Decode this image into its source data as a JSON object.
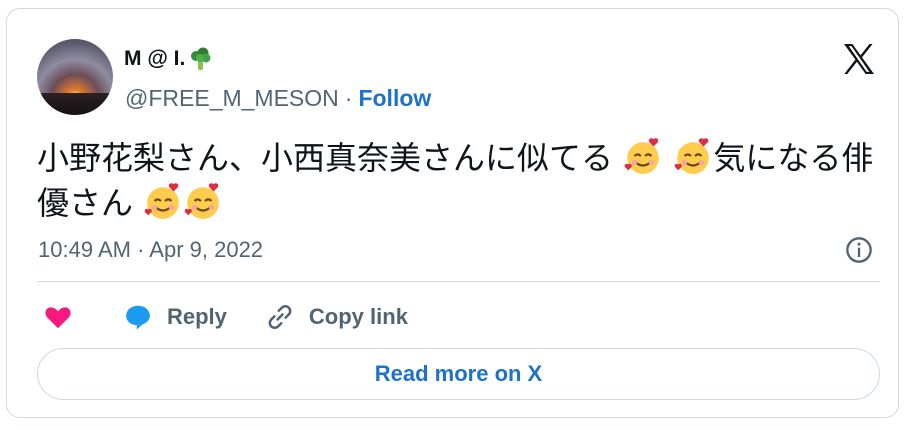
{
  "user": {
    "display_name": "M @ I.",
    "handle": "@FREE_M_MESON",
    "follow_label": "Follow",
    "separator": "·"
  },
  "tweet": {
    "text_part1": "小野花梨さん、小西真奈美さんに似てる",
    "text_part2": "気になる俳優さん",
    "timestamp": "10:49 AM · Apr 9, 2022"
  },
  "actions": {
    "reply_label": "Reply",
    "copy_link_label": "Copy link"
  },
  "footer": {
    "read_more_label": "Read more on X"
  },
  "icons": [
    "broccoli-emoji-icon",
    "x-logo-icon",
    "smiling-face-with-hearts-icon",
    "info-icon",
    "heart-icon",
    "reply-bubble-icon",
    "link-icon"
  ],
  "colors": {
    "link_blue": "#1d72c9",
    "heart_pink": "#f91880",
    "reply_blue": "#1d9bf0",
    "muted_text": "#536471",
    "border": "#cfd9de"
  }
}
